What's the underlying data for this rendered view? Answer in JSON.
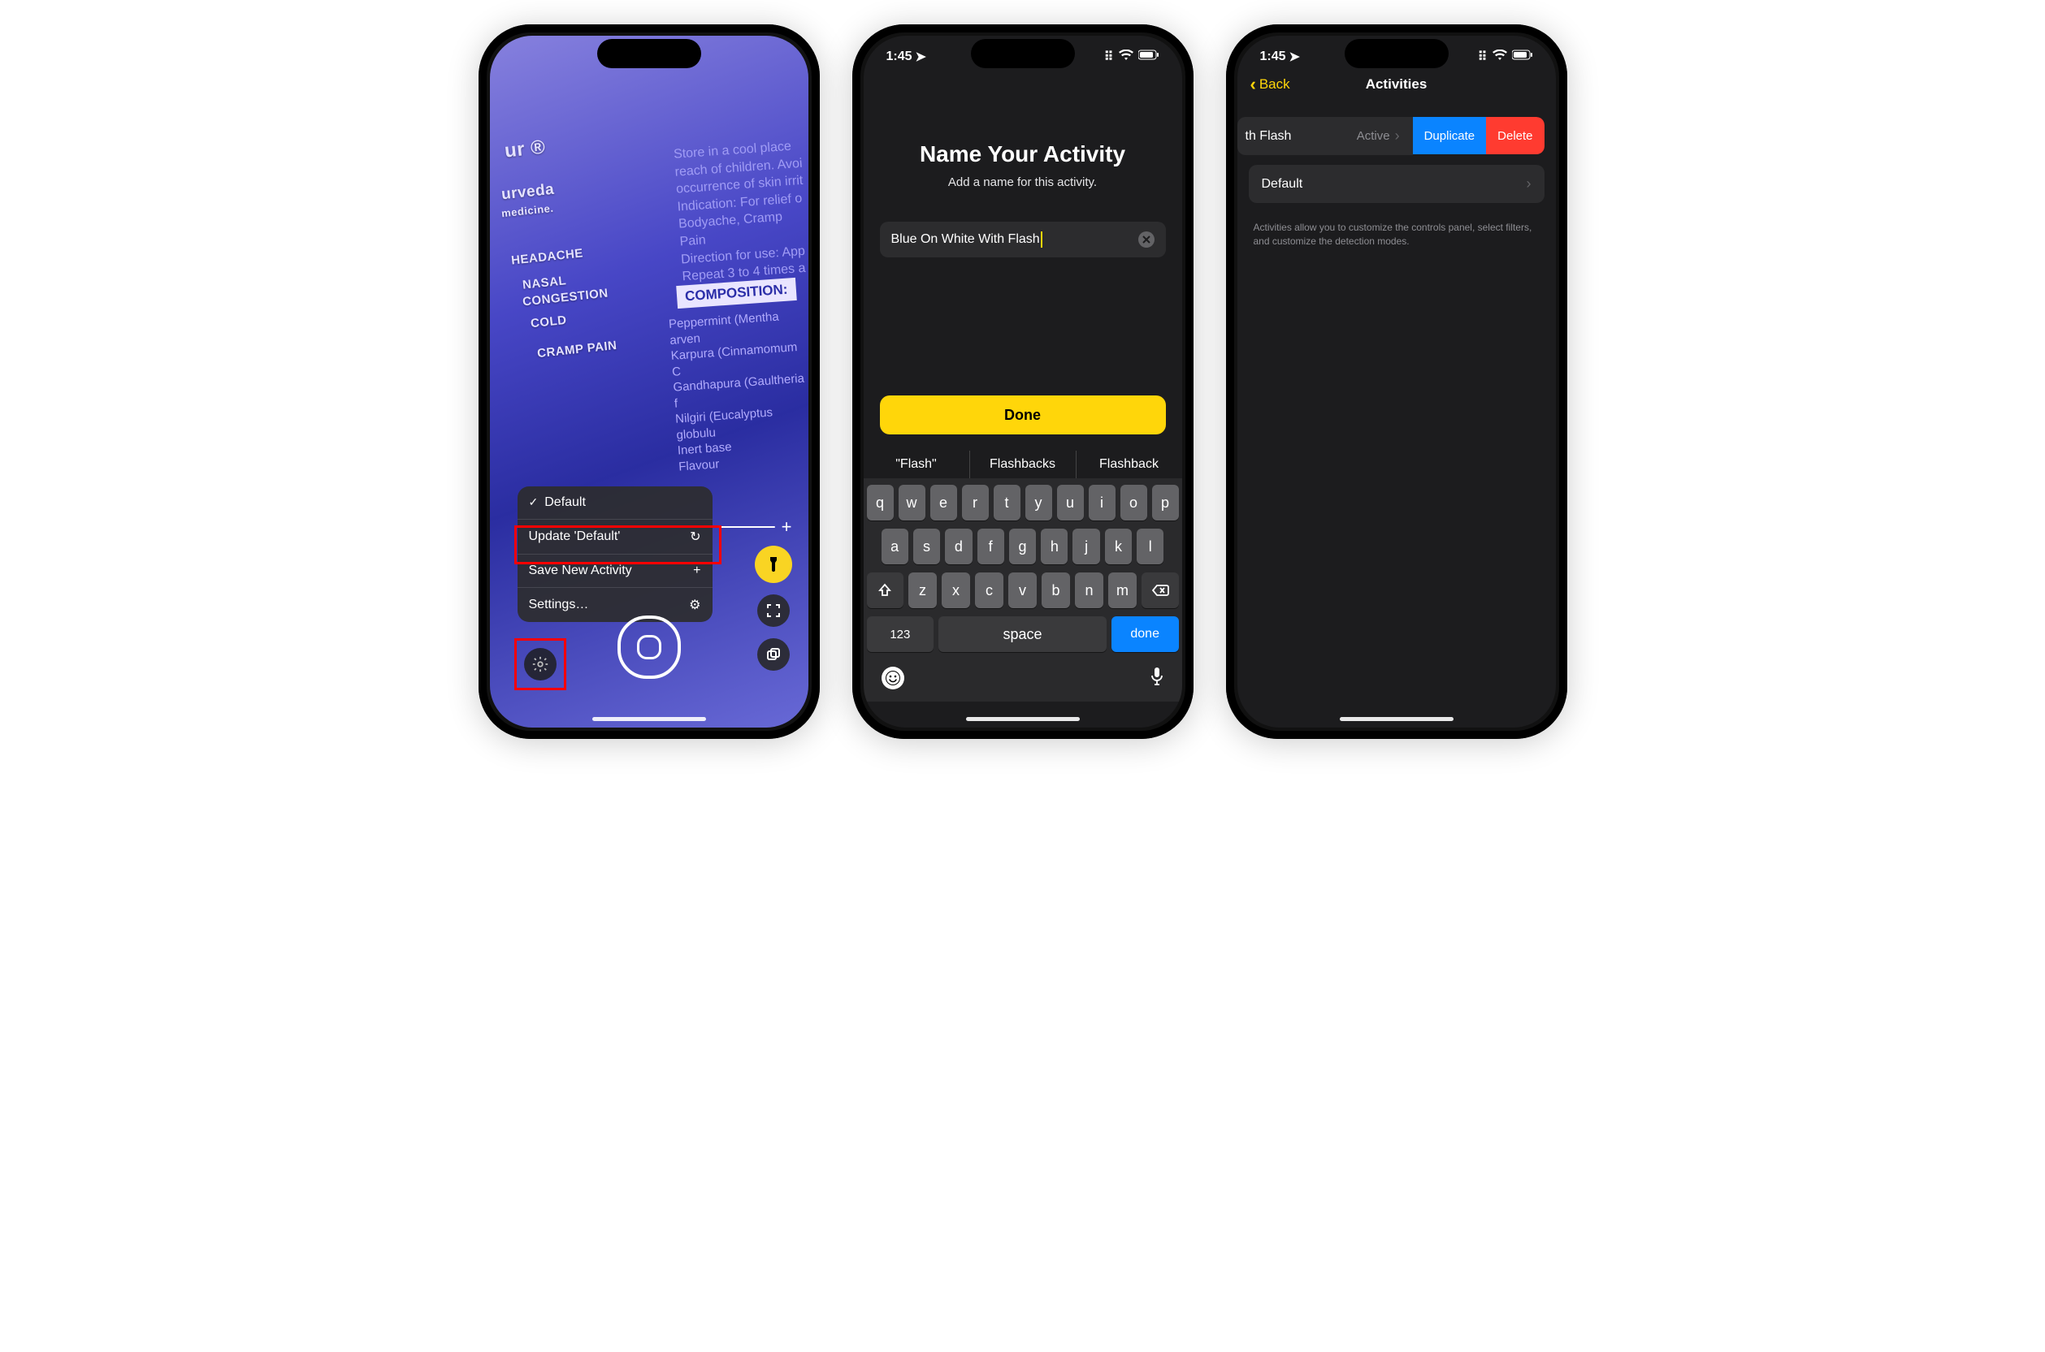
{
  "phone1": {
    "bg_text": {
      "instructions": "Store in a cool place\nreach of children. Avoi\noccurrence of skin irrit\nIndication: For relief o\nBodyache, Cramp Pain\nDirection for use: App\nRepeat 3 to 4 times a d",
      "composition": "COMPOSITION:",
      "ingredients": "Peppermint (Mentha arven\nKarpura (Cinnamomum C\nGandhapura (Gaultheria f\nNilgiri (Eucalyptus globulu\nInert base\nFlavour",
      "side_labels": [
        "HEADACHE",
        "NASAL",
        "CONGESTION",
        "COLD",
        "CRAMP PAIN"
      ],
      "brand_partial": "ur ®",
      "urveda": "urveda",
      "medicine": "medicine."
    },
    "menu": {
      "default": "Default",
      "update": "Update 'Default'",
      "save_new": "Save New Activity",
      "settings": "Settings…"
    }
  },
  "status": {
    "time": "1:45"
  },
  "phone2": {
    "title": "Name Your Activity",
    "subtitle": "Add a name for this activity.",
    "input_value": "Blue On White With Flash",
    "done": "Done",
    "suggestions": [
      "\"Flash\"",
      "Flashbacks",
      "Flashback"
    ],
    "kb_123": "123",
    "kb_space": "space",
    "kb_done": "done"
  },
  "phone3": {
    "back": "Back",
    "title": "Activities",
    "row1_label": "th Flash",
    "row1_status": "Active",
    "duplicate": "Duplicate",
    "delete": "Delete",
    "row2_label": "Default",
    "footer": "Activities allow you to customize the controls panel, select filters, and customize the detection modes."
  }
}
